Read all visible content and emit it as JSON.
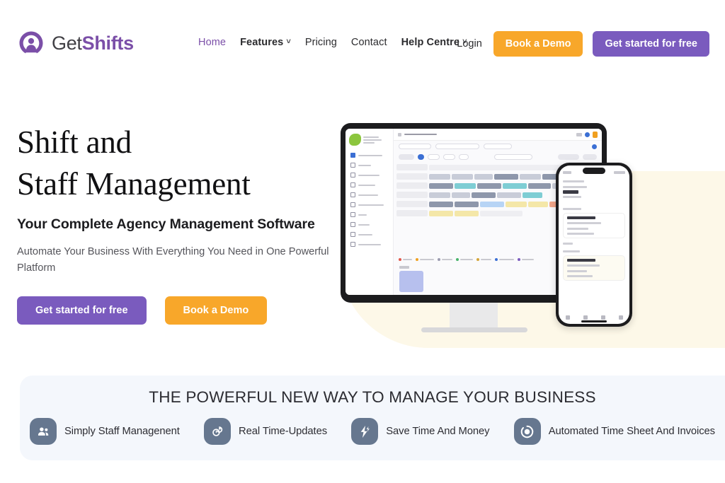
{
  "brand": {
    "logo_icon": "location-pin-person-icon",
    "name_part1": "Get",
    "name_part2": "Shifts",
    "purple": "#7B4FA8",
    "button_purple": "#7A5BBE",
    "button_orange": "#F8A72A",
    "banner_bg": "#F4F7FC",
    "blob_cream": "#FDF8E8",
    "feature_icon_bg": "#66778F"
  },
  "nav": {
    "items": [
      {
        "label": "Home",
        "active": true,
        "has_caret": false
      },
      {
        "label": "Features",
        "active": false,
        "has_caret": true
      },
      {
        "label": "Pricing",
        "active": false,
        "has_caret": false
      },
      {
        "label": "Contact",
        "active": false,
        "has_caret": false
      },
      {
        "label": "Help Centre",
        "active": false,
        "has_caret": true
      }
    ],
    "caret_glyph": "˅"
  },
  "header_actions": {
    "login_label": "Login",
    "demo_label": "Book a Demo",
    "signup_label": "Get started for free"
  },
  "hero": {
    "title_line1": "Shift and",
    "title_line2": "Staff Management",
    "subtitle": "Your Complete Agency Management Software",
    "description": "Automate Your Business With Everything You Need in One Powerful Platform",
    "cta_primary": "Get started for free",
    "cta_secondary": "Book a Demo"
  },
  "banner": {
    "heading": "THE POWERFUL NEW WAY TO MANAGE YOUR BUSINESS",
    "features": [
      {
        "label": "Simply Staff Managenent",
        "icon": "two-people-icon"
      },
      {
        "label": "Real Time-Updates",
        "icon": "clock-refresh-icon"
      },
      {
        "label": "Save Time And Money",
        "icon": "lightning-bolt-icon"
      },
      {
        "label": "Automated Time Sheet And Invoices",
        "icon": "ring-circle-icon"
      }
    ]
  },
  "hero_art": {
    "monitor_alt": "scheduling-dashboard-screenshot",
    "phone_alt": "mobile-shift-app-screenshot"
  }
}
